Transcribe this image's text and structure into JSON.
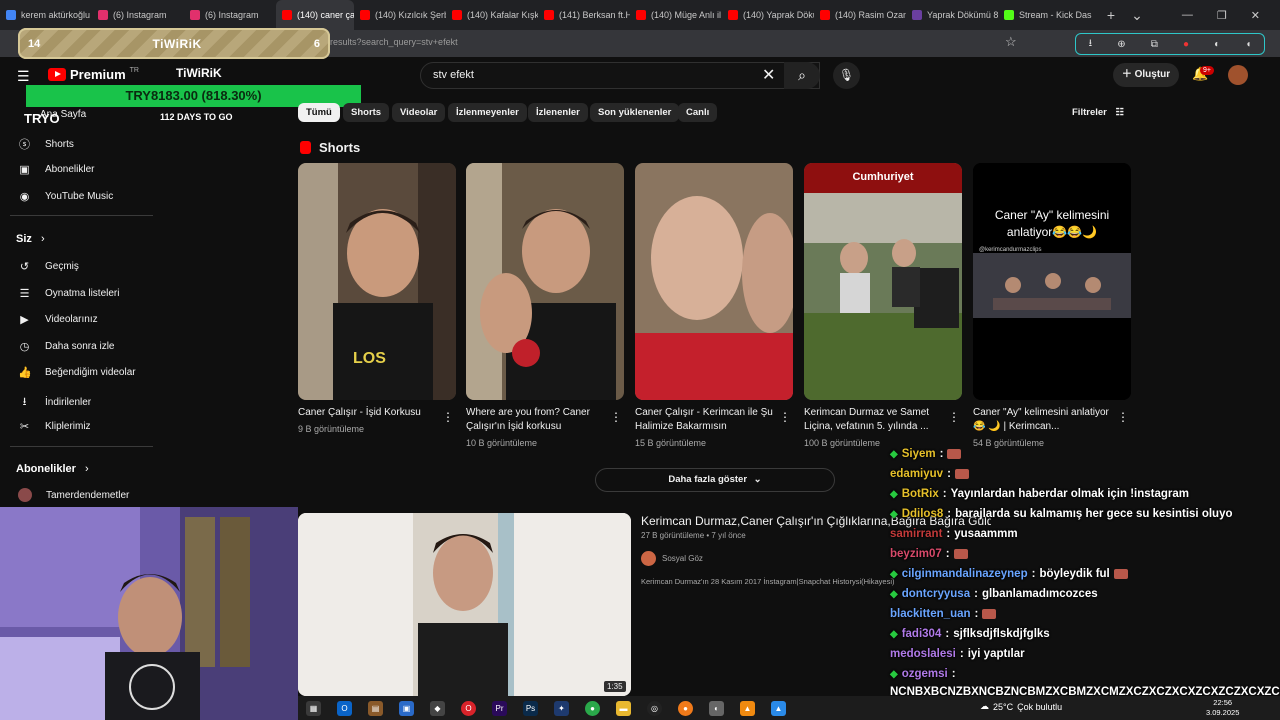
{
  "browser": {
    "tabs": [
      {
        "label": "kerem aktürkoğlu",
        "color": "#4285f4"
      },
      {
        "label": "(6) Instagram",
        "color": "#e1306c"
      },
      {
        "label": "(6) Instagram",
        "color": "#e1306c"
      },
      {
        "label": "(140) caner çal",
        "color": "#ff0000",
        "active": true
      },
      {
        "label": "(140) Kızılcık Şerb",
        "color": "#ff0000"
      },
      {
        "label": "(140) Kafalar Kışk",
        "color": "#ff0000"
      },
      {
        "label": "(141) Berksan ft.H",
        "color": "#ff0000"
      },
      {
        "label": "(140) Müge Anlı il",
        "color": "#ff0000"
      },
      {
        "label": "(140) Yaprak Dökü",
        "color": "#ff0000"
      },
      {
        "label": "(140) Rasim Ozan",
        "color": "#ff0000"
      },
      {
        "label": "Yaprak Dökümü 8",
        "color": "#6a3fa0"
      },
      {
        "label": "Stream - Kick Das",
        "color": "#53fc18"
      }
    ],
    "tab_close": "✕",
    "new_tab": "+",
    "tab_menu": "⌄",
    "window_controls": {
      "minimize": "—",
      "restore": "❐",
      "close": "✕"
    },
    "url": "results?search_query=stv+efekt"
  },
  "overlay": {
    "tiwirik_left": "14",
    "tiwirik_title": "TiWiRiK",
    "tiwirik_right": "6",
    "tiwirik_logo": "TiWiRiK",
    "try_value": "TRY8183.00 (818.30%)",
    "try_label": "TRYO",
    "try_suffix": "RY1000",
    "days_to_go": "112 DAYS TO GO"
  },
  "youtube": {
    "brand": "Premium",
    "region": "TR",
    "search_value": "stv efekt",
    "create_label": "Oluştur",
    "notifications": "9+",
    "filters_label": "Filtreler",
    "chips": [
      "Tümü",
      "Shorts",
      "Videolar",
      "İzlenmeyenler",
      "İzlenenler",
      "Son yüklenenler",
      "Canlı"
    ],
    "sidebar": {
      "home": "Ana Sayfa",
      "items_top": [
        "Shorts",
        "Abonelikler",
        "YouTube Music"
      ],
      "you_heading": "Siz",
      "items_you": [
        "Geçmiş",
        "Oynatma listeleri",
        "Videolarınız",
        "Daha sonra izle",
        "Beğendiğim videolar",
        "İndirilenler",
        "Kliplerimiz"
      ],
      "subs_heading": "Abonelikler",
      "subscription": "Tamerdendemetler"
    },
    "shorts_heading": "Shorts",
    "shorts": [
      {
        "title": "Caner Çalışır - İşid Korkusu",
        "views": "9 B görüntüleme",
        "overlay": ""
      },
      {
        "title": "Where are you from? Caner Çalışır'ın İşid korkusu",
        "views": "10 B görüntüleme",
        "overlay": ""
      },
      {
        "title": "Caner Çalışır - Kerimcan ile Şu Halimize Bakarmısın",
        "views": "15 B görüntüleme",
        "overlay": ""
      },
      {
        "title": "Kerimcan Durmaz ve Samet Liçina, vefatının 5. yılında ...",
        "views": "100 B görüntüleme",
        "overlay": "Cumhuriyet"
      },
      {
        "title": "Caner \"Ay\" kelimesini anlatiyor😂 🌙 | Kerimcan...",
        "views": "54 B görüntüleme",
        "overlay": "Caner \"Ay\" kelimesini anlatiyor😂😂🌙",
        "handle": "@kerimcandurmazclips"
      }
    ],
    "show_more": "Daha fazla göster",
    "video": {
      "title": "Kerimcan Durmaz,Caner Çalışır'ın Çığlıklarına,Bağıra Bağıra Güldü",
      "meta": "27 B görüntüleme • 7 yıl önce",
      "channel": "Sosyal Göz",
      "description": "Kerimcan Durmaz'ın 28 Kasım 2017 İnstagram|Snapchat Historysi(Hikayesi)",
      "duration": "1:35"
    }
  },
  "chat": [
    {
      "user": "Siyem",
      "msg": "",
      "color": "#e6c02a",
      "diamond": true,
      "emote": true
    },
    {
      "user": "edamiyuv",
      "msg": "",
      "color": "#e6c02a",
      "diamond": false,
      "emote": true
    },
    {
      "user": "BotRix",
      "msg": "Yayınlardan haberdar olmak için !instagram",
      "color": "#e6c02a",
      "diamond": true,
      "emote": false
    },
    {
      "user": "Ddilos8",
      "msg": "barajlarda su kalmamış her gece su kesintisi oluyo",
      "color": "#e6c02a",
      "diamond": true,
      "emote": false
    },
    {
      "user": "samirrant",
      "msg": "yusaammm",
      "color": "#c23a3a",
      "diamond": false,
      "emote": false
    },
    {
      "user": "beyzim07",
      "msg": "",
      "color": "#d84a6a",
      "diamond": false,
      "emote": true
    },
    {
      "user": "cilginmandalinazeynep",
      "msg": "böyleydik ful",
      "color": "#6aa5ff",
      "diamond": true,
      "emote": true
    },
    {
      "user": "dontcryyusa",
      "msg": "glbanlamadımcozces",
      "color": "#6aa5ff",
      "diamond": true,
      "emote": false
    },
    {
      "user": "blackitten_uan",
      "msg": "",
      "color": "#6aa5ff",
      "diamond": false,
      "emote": true
    },
    {
      "user": "fadi304",
      "msg": "sjflksdjflskdjfglks",
      "color": "#b07ae8",
      "diamond": true,
      "emote": false
    },
    {
      "user": "medoslalesi",
      "msg": "iyi yaptılar",
      "color": "#b07ae8",
      "diamond": false,
      "emote": false
    },
    {
      "user": "ozgemsi",
      "msg": "",
      "color": "#b07ae8",
      "diamond": true,
      "emote": false
    }
  ],
  "chat_long": "NCNBXBCNZBXNCBZNCBMZXCBMZXCMZXCZXCZXCXZCXZCZXCXZCZC",
  "taskbar": {
    "weather": "25°C",
    "weather_desc": "Çok bulutlu",
    "time": "22:56",
    "date": "3.09.2025"
  }
}
